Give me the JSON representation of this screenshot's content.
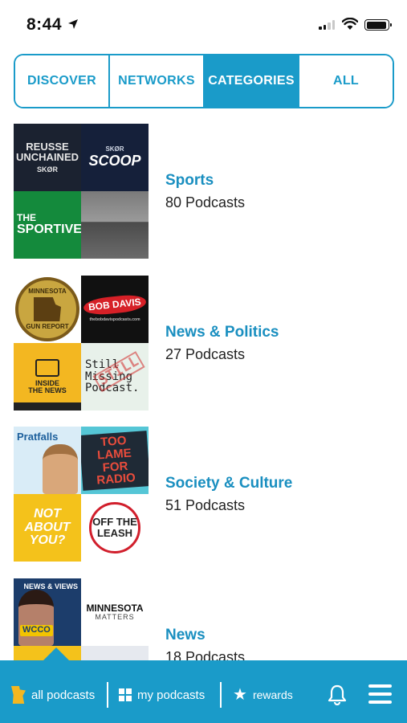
{
  "status_bar": {
    "time": "8:44"
  },
  "tabs": [
    {
      "label": "DISCOVER",
      "active": false
    },
    {
      "label": "NETWORKS",
      "active": false
    },
    {
      "label": "CATEGORIES",
      "active": true
    },
    {
      "label": "ALL",
      "active": false
    }
  ],
  "categories": [
    {
      "title": "Sports",
      "count": "80 Podcasts",
      "artwork": {
        "reusse": {
          "line1": "REUSSE",
          "line2": "UNCHAINED",
          "brand": "SKØR"
        },
        "scoop": {
          "brand": "SKØR",
          "title": "SCOOP"
        },
        "sportive": {
          "line1": "THE",
          "line2": "SPORTIVE"
        }
      }
    },
    {
      "title": "News & Politics",
      "count": "27 Podcasts",
      "artwork": {
        "gun": {
          "line1": "MINNESOTA",
          "line2": "GUN REPORT"
        },
        "bob": {
          "badge": "BOB DAVIS",
          "url": "thebobdavispodcasts.com"
        },
        "inside": {
          "line1": "INSIDE",
          "line2": "THE NEWS"
        },
        "still": {
          "line1": "Still",
          "line2": "Missing",
          "line3": "Podcast.",
          "stamp": "STILL"
        }
      }
    },
    {
      "title": "Society & Culture",
      "count": "51 Podcasts",
      "artwork": {
        "pratfalls": {
          "title": "Pratfalls"
        },
        "toolame": {
          "title": "TOO LAME FOR RADIO"
        },
        "notabout": {
          "line1": "NOT ABOUT",
          "line2": "YOU?"
        },
        "leash": {
          "title": "OFF THE LEASH"
        }
      }
    },
    {
      "title": "News",
      "count": "18 Podcasts",
      "artwork": {
        "wcco": {
          "label": "NEWS & VIEWS",
          "badge": "WCCO"
        },
        "mnmatters": {
          "title": "MINNESOTA",
          "sub": "MATTERS"
        }
      }
    }
  ],
  "bottom_nav": {
    "all_podcasts": "all podcasts",
    "my_podcasts": "my podcasts",
    "rewards": "rewards",
    "icons": [
      "minnesota-icon",
      "grid-icon",
      "star-icon",
      "bell-icon",
      "menu-icon"
    ]
  },
  "colors": {
    "accent": "#1a9bc9",
    "title": "#1a8fc0"
  }
}
